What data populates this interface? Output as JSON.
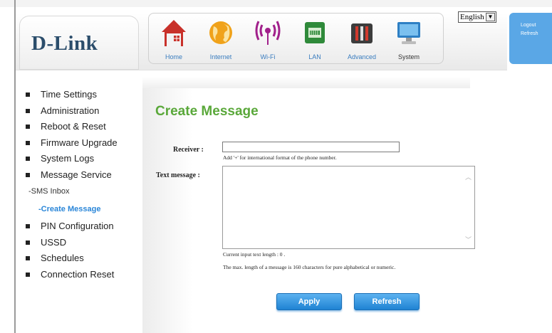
{
  "header": {
    "logo": "D-Link",
    "language": "English",
    "user_links": [
      "Logout",
      "Refresh"
    ],
    "nav": [
      {
        "label": "Home",
        "icon": "home-icon"
      },
      {
        "label": "Internet",
        "icon": "globe-icon"
      },
      {
        "label": "Wi-Fi",
        "icon": "wifi-icon"
      },
      {
        "label": "LAN",
        "icon": "lan-icon"
      },
      {
        "label": "Advanced",
        "icon": "tools-icon"
      },
      {
        "label": "System",
        "icon": "monitor-icon"
      }
    ],
    "active_nav": "System"
  },
  "sidebar": {
    "items": [
      {
        "label": "Time Settings"
      },
      {
        "label": "Administration"
      },
      {
        "label": "Reboot & Reset"
      },
      {
        "label": "Firmware Upgrade"
      },
      {
        "label": "System Logs"
      },
      {
        "label": "Message Service"
      },
      {
        "label": "PIN Configuration"
      },
      {
        "label": "USSD"
      },
      {
        "label": "Schedules"
      },
      {
        "label": "Connection Reset"
      }
    ],
    "sub_items": [
      {
        "label": "-SMS Inbox"
      },
      {
        "label": "-Create Message"
      }
    ],
    "active_sub": "-Create Message"
  },
  "main": {
    "title": "Create Message",
    "receiver_label": "Receiver :",
    "receiver_value": "",
    "receiver_hint": "Add '+' for international format of the phone number.",
    "text_label": "Text message :",
    "text_value": "",
    "length_text": "Current input text length :  0 .",
    "max_text": "The max. length of a message is 160 characters for pure alphabetical or numeric.",
    "apply_label": "Apply",
    "refresh_label": "Refresh"
  }
}
